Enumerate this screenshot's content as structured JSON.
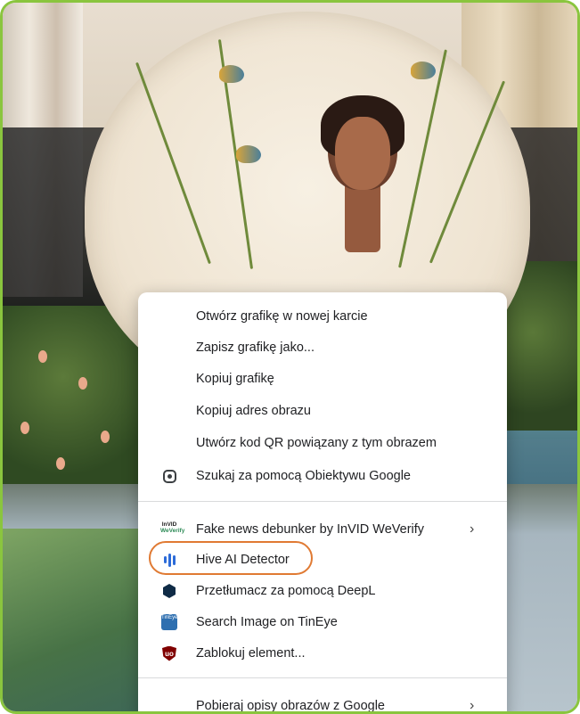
{
  "context_menu": {
    "items": [
      {
        "label": "Otwórz grafikę w nowej karcie",
        "icon": ""
      },
      {
        "label": "Zapisz grafikę jako...",
        "icon": ""
      },
      {
        "label": "Kopiuj grafikę",
        "icon": ""
      },
      {
        "label": "Kopiuj adres obrazu",
        "icon": ""
      },
      {
        "label": "Utwórz kod QR powiązany z tym obrazem",
        "icon": ""
      },
      {
        "label": "Szukaj za pomocą Obiektywu Google",
        "icon": "google-lens-icon"
      },
      {
        "label": "Fake news debunker by InVID  WeVerify",
        "icon": "invid-icon",
        "has_submenu": true
      },
      {
        "label": "Hive AI Detector",
        "icon": "hive-icon"
      },
      {
        "label": "Przetłumacz za pomocą DeepL",
        "icon": "deepl-icon"
      },
      {
        "label": "Search Image on TinEye",
        "icon": "tineye-icon"
      },
      {
        "label": "Zablokuj element...",
        "icon": "ublock-icon"
      },
      {
        "label": "Pobieraj opisy obrazów z Google",
        "icon": "",
        "has_submenu": true
      }
    ],
    "submenu_arrow": "›",
    "icon_text": {
      "invid_top": "InVID",
      "invid_bottom": "WeVerify",
      "tineye": "TinEye",
      "ublock": "uo"
    }
  },
  "highlight": {
    "target": "Hive AI Detector",
    "color": "#e07a33"
  },
  "frame": {
    "border_color": "#8ac53e"
  }
}
